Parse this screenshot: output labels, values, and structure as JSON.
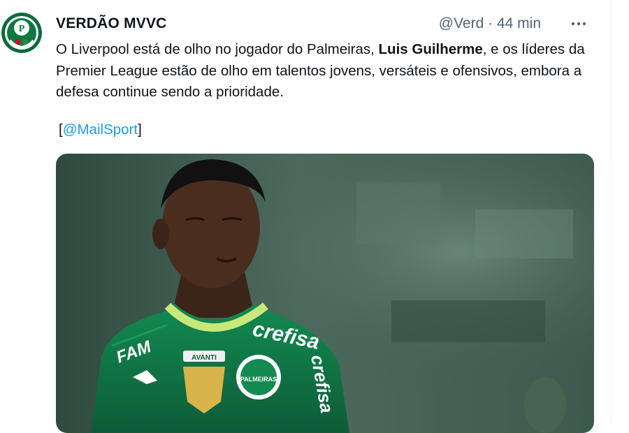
{
  "tweet": {
    "author": {
      "display_name": "VERDÃO MVVC",
      "handle": "@Verd",
      "avatar_letter": "P"
    },
    "separator": "·",
    "time": "44 min",
    "more_icon": "more-horizontal-icon",
    "text": {
      "part1": "O Liverpool está de olho no jogador do Palmeiras, ",
      "bold": "Luis Guilherme",
      "part2": ", e os líderes da Premier League estão de olho em talentos jovens, versáteis e ofensivos, embora a defesa continue sendo a prioridade."
    },
    "mention": {
      "open": "[",
      "label": "@MailSport",
      "close": "]"
    },
    "photo": {
      "shirt_sponsor_front": "crefisa",
      "shirt_sponsor_sleeve": "crefisa",
      "shirt_brand": "FAM",
      "club_badge_text": "PALMEIRAS",
      "patch_text": "AVANTI"
    }
  },
  "colors": {
    "accent": "#1d9bf0",
    "text": "#0f1419",
    "secondary": "#536471",
    "jersey": "#0f6b42"
  }
}
